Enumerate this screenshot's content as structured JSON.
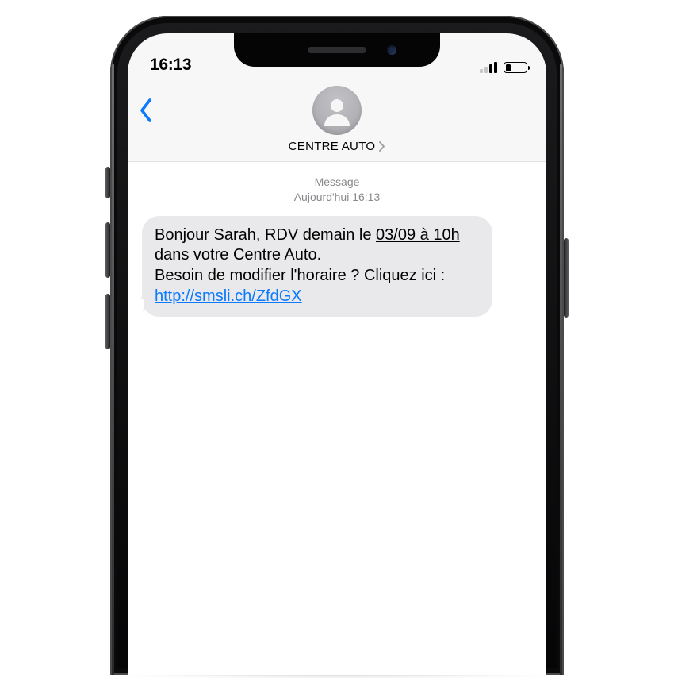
{
  "status": {
    "time": "16:13"
  },
  "header": {
    "contact_name": "CENTRE AUTO"
  },
  "thread": {
    "label": "Message",
    "timestamp": "Aujourd'hui 16:13"
  },
  "message": {
    "part1": "Bonjour Sarah, RDV demain le ",
    "detected_date": "03/09 à 10h",
    "part2": " dans votre Centre Auto.",
    "part3": "Besoin de modifier l'horaire ? Cliquez ici : ",
    "link_text": "http://smsli.ch/ZfdGX",
    "link_href": "http://smsli.ch/ZfdGX"
  }
}
